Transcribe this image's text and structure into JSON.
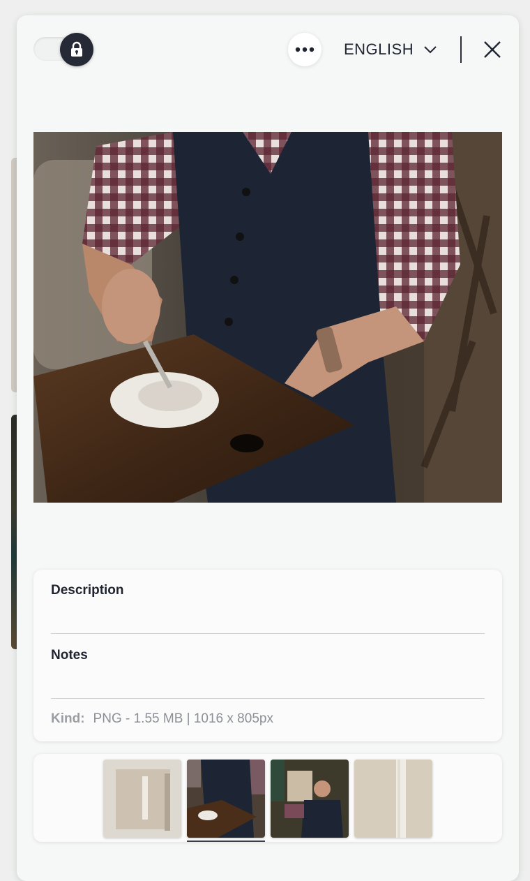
{
  "header": {
    "lock_toggle_state": "locked",
    "more_icon": "more-horizontal-icon",
    "language": "ENGLISH",
    "close_icon": "close-icon"
  },
  "image": {
    "subject": "artist-palette-photo"
  },
  "info": {
    "description_label": "Description",
    "notes_label": "Notes",
    "kind_label": "Kind:",
    "kind_value": "PNG - 1.55 MB | 1016 x 805px"
  },
  "thumbnails": {
    "selected_index": 1,
    "count": 4
  },
  "colors": {
    "knob": "#262a36",
    "modal_bg": "#f6f8f7",
    "muted_text": "#8c9096"
  }
}
